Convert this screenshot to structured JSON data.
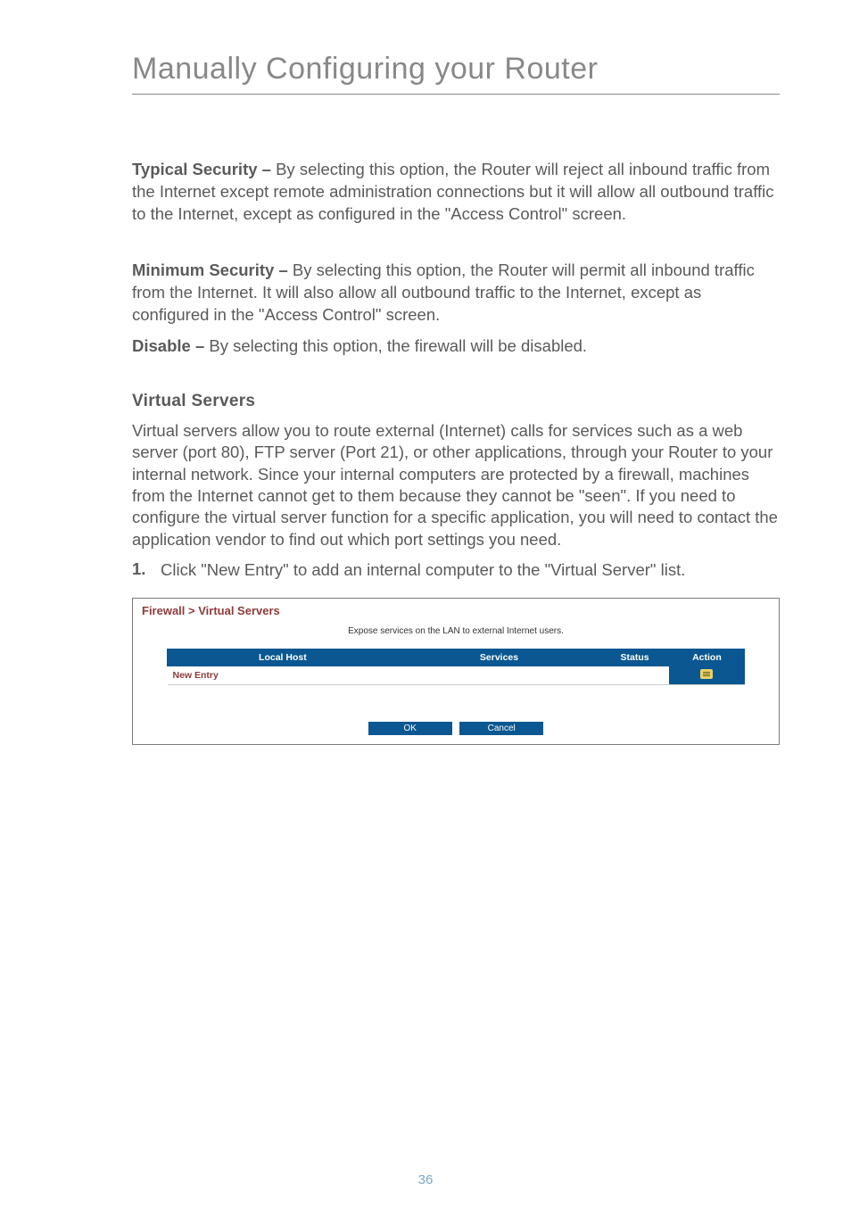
{
  "page": {
    "title": "Manually Configuring your Router",
    "number": "36"
  },
  "sections": {
    "typical_security": {
      "label": "Typical Security – ",
      "text": "By selecting this option, the Router will reject all inbound traffic from the Internet except remote administration connections but it will allow all outbound traffic to the Internet, except as configured in the \"Access Control\" screen."
    },
    "minimum_security": {
      "label": "Minimum Security – ",
      "text": "By selecting this option, the Router will permit all inbound traffic from the Internet. It will also allow all outbound traffic to the Internet, except as configured in the \"Access Control\" screen."
    },
    "disable": {
      "label": "Disable – ",
      "text": "By selecting this option, the firewall will be disabled."
    },
    "virtual_servers": {
      "heading": "Virtual Servers",
      "body": "Virtual servers allow you to route external (Internet) calls for services such as a web server (port 80), FTP server (Port 21), or other applications, through your Router to your internal network. Since your internal computers are protected by a firewall, machines from the Internet cannot get to them because they cannot be \"seen\". If you need to configure the virtual server function for a specific application, you will need to contact the application vendor to find out which port settings you need.",
      "step_number": "1.",
      "step_text": "Click \"New Entry\" to add an internal computer to the \"Virtual Server\" list."
    }
  },
  "screenshot": {
    "breadcrumb": "Firewall > Virtual Servers",
    "subtitle": "Expose services on the LAN to external Internet users.",
    "columns": {
      "local_host": "Local Host",
      "services": "Services",
      "status": "Status",
      "action": "Action"
    },
    "row": {
      "new_entry": "New Entry"
    },
    "buttons": {
      "ok": "OK",
      "cancel": "Cancel"
    }
  }
}
